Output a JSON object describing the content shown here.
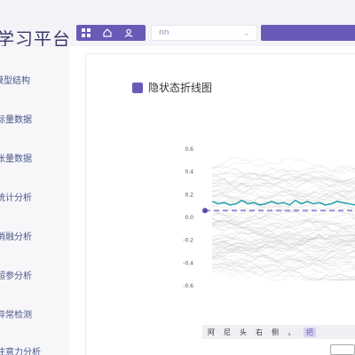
{
  "header": {
    "app_title": "学习平台",
    "select_value": "nn",
    "toolbar_icons": [
      "grid-icon",
      "home-icon",
      "user-icon"
    ]
  },
  "sidebar": {
    "items": [
      {
        "label": "模型结构"
      },
      {
        "label": "标量数据"
      },
      {
        "label": "张量数据"
      },
      {
        "label": "统计分析"
      },
      {
        "label": "消融分析"
      },
      {
        "label": "超参分析"
      },
      {
        "label": "异常检测"
      },
      {
        "label": "注意力分析"
      }
    ]
  },
  "card": {
    "title": "隐状态折线图"
  },
  "chart_data": {
    "type": "line",
    "title": "",
    "xlabel": "",
    "ylabel": "",
    "y_ticks": [
      "0.6",
      "0.4",
      "0.2",
      "0.0",
      "-0.2",
      "-0.4",
      "-0.6"
    ],
    "ylim": [
      -0.6,
      0.6
    ],
    "highlight_series": {
      "values": [
        0.14,
        0.12,
        0.13,
        0.11,
        0.12,
        0.15,
        0.12,
        0.13,
        0.11,
        0.12,
        0.14,
        0.12,
        0.13,
        0.11,
        0.15,
        0.12,
        0.14,
        0.12,
        0.13,
        0.11,
        0.12,
        0.14,
        0.13,
        0.12,
        0.11
      ],
      "color": "#2aa3ad"
    },
    "reference_value": 0.06,
    "reference_color": "#9b8fd6",
    "background_color": "#bdbdbd"
  },
  "bottom_bar": {
    "tokens": [
      "阿",
      "尼",
      "头",
      "右",
      "侧",
      "，"
    ],
    "highlight": "把"
  },
  "colors": {
    "accent": "#6a5ab8",
    "sidebar_text": "#4a5688"
  }
}
